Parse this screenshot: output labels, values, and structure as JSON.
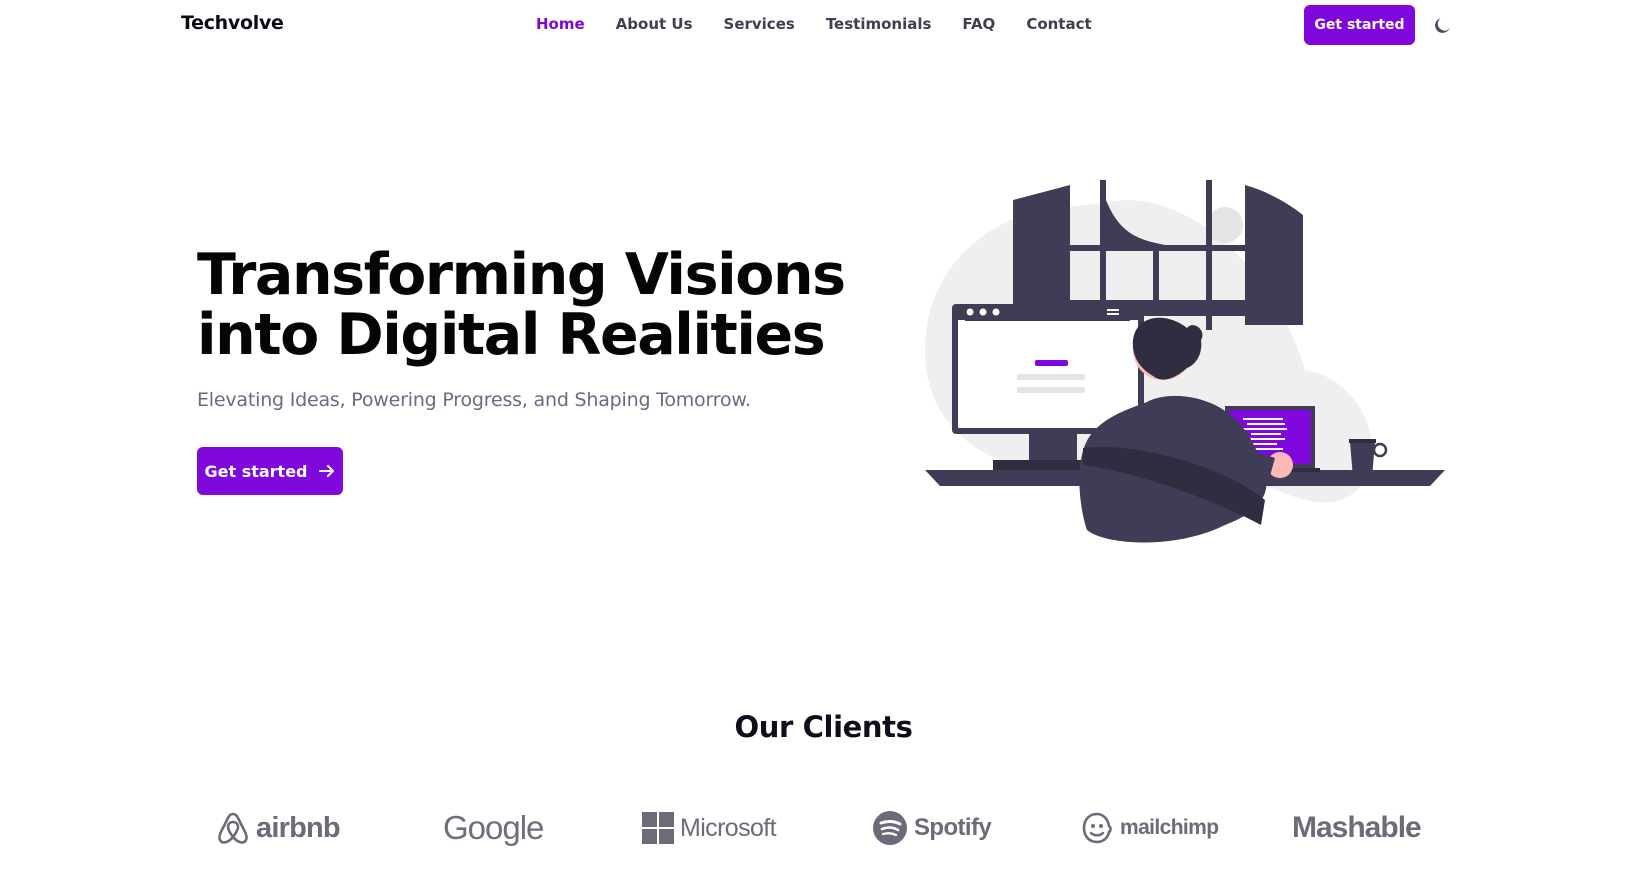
{
  "brand": "Techvolve",
  "nav": {
    "items": [
      {
        "label": "Home",
        "active": true
      },
      {
        "label": "About Us",
        "active": false
      },
      {
        "label": "Services",
        "active": false
      },
      {
        "label": "Testimonials",
        "active": false
      },
      {
        "label": "FAQ",
        "active": false
      },
      {
        "label": "Contact",
        "active": false
      }
    ],
    "cta_label": "Get started",
    "theme_icon": "moon-icon"
  },
  "hero": {
    "title_line1": "Transforming Visions",
    "title_line2": "into Digital Realities",
    "subtitle": "Elevating Ideas, Powering Progress, and Shaping Tomorrow.",
    "cta_label": "Get started",
    "cta_icon": "arrow-right-icon",
    "illustration": "person-working-at-computer-illustration"
  },
  "clients": {
    "title": "Our Clients",
    "logos": [
      {
        "name": "airbnb",
        "icon": "airbnb-icon"
      },
      {
        "name": "Google",
        "icon": ""
      },
      {
        "name": "Microsoft",
        "icon": "microsoft-icon"
      },
      {
        "name": "Spotify",
        "icon": "spotify-icon"
      },
      {
        "name": "mailchimp",
        "icon": "mailchimp-icon"
      },
      {
        "name": "Mashable",
        "icon": ""
      }
    ]
  },
  "colors": {
    "accent": "#8008dd",
    "text_dark": "#050507",
    "text_muted": "#6b6b80",
    "illustration_dark": "#3f3d56",
    "logo_gray": "#6b6b7a"
  }
}
